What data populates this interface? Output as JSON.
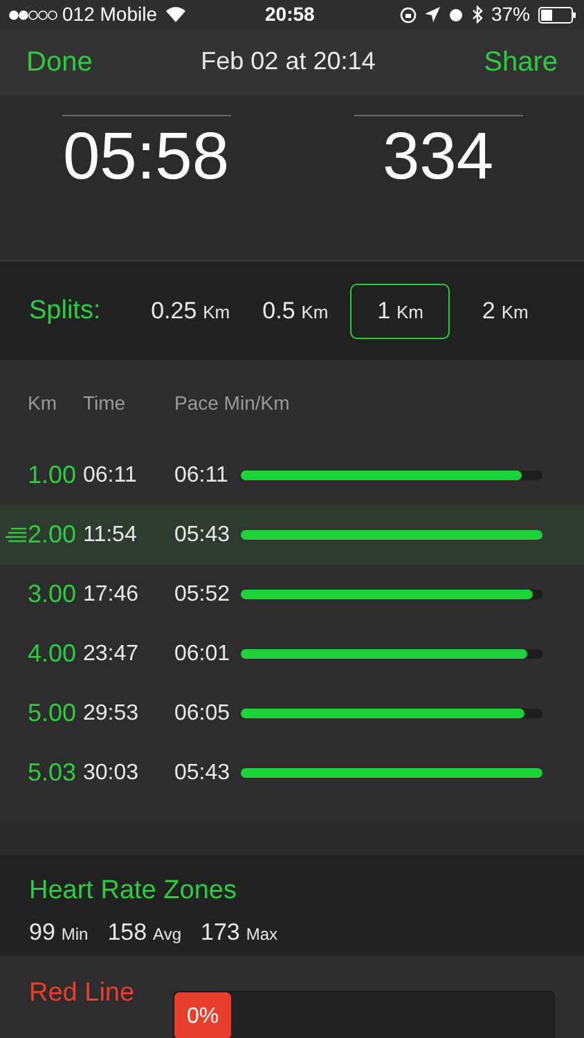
{
  "status_bar": {
    "carrier": "012 Mobile",
    "time": "20:58",
    "battery": "37%"
  },
  "nav": {
    "left": "Done",
    "title": "Feb 02 at 20:14",
    "right": "Share"
  },
  "stats": [
    {
      "value": "05:58"
    },
    {
      "value": "334"
    }
  ],
  "splits": {
    "label": "Splits:",
    "options": [
      {
        "value": "0.25",
        "unit": "Km",
        "selected": false
      },
      {
        "value": "0.5",
        "unit": "Km",
        "selected": false
      },
      {
        "value": "1",
        "unit": "Km",
        "selected": true
      },
      {
        "value": "2",
        "unit": "Km",
        "selected": false
      }
    ]
  },
  "table": {
    "columns": [
      "Km",
      "Time",
      "Pace Min/Km"
    ],
    "rows": [
      {
        "km": "1.00",
        "time": "06:11",
        "pace": "06:11",
        "level": 0.93,
        "selected": false
      },
      {
        "km": "2.00",
        "time": "11:54",
        "pace": "05:43",
        "level": 1.0,
        "selected": true
      },
      {
        "km": "3.00",
        "time": "17:46",
        "pace": "05:52",
        "level": 0.97,
        "selected": false
      },
      {
        "km": "4.00",
        "time": "23:47",
        "pace": "06:01",
        "level": 0.95,
        "selected": false
      },
      {
        "km": "5.00",
        "time": "29:53",
        "pace": "06:05",
        "level": 0.94,
        "selected": false
      },
      {
        "km": "5.03",
        "time": "30:03",
        "pace": "05:43",
        "level": 1.0,
        "selected": false
      }
    ]
  },
  "heart_rate": {
    "title": "Heart Rate Zones",
    "stats": [
      {
        "value": "99",
        "unit": "Min"
      },
      {
        "value": "158",
        "unit": "Avg"
      },
      {
        "value": "173",
        "unit": "Max"
      }
    ]
  },
  "zones": [
    {
      "name": "Red Line",
      "percent": "0%",
      "color": "#e8402c"
    }
  ]
}
